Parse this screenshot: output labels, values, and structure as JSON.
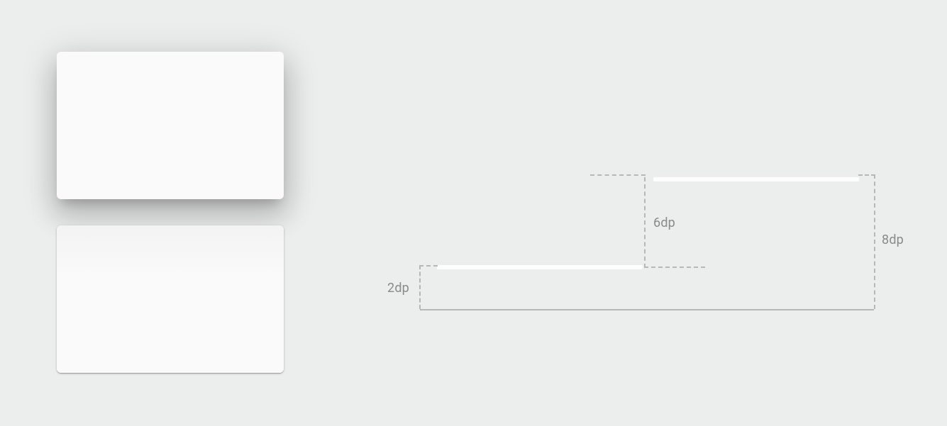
{
  "left_panel": {
    "cards": [
      {
        "role": "high-elevation-card"
      },
      {
        "role": "low-elevation-card"
      }
    ]
  },
  "diagram": {
    "labels": {
      "dp2": "2dp",
      "dp6": "6dp",
      "dp8": "8dp"
    }
  }
}
